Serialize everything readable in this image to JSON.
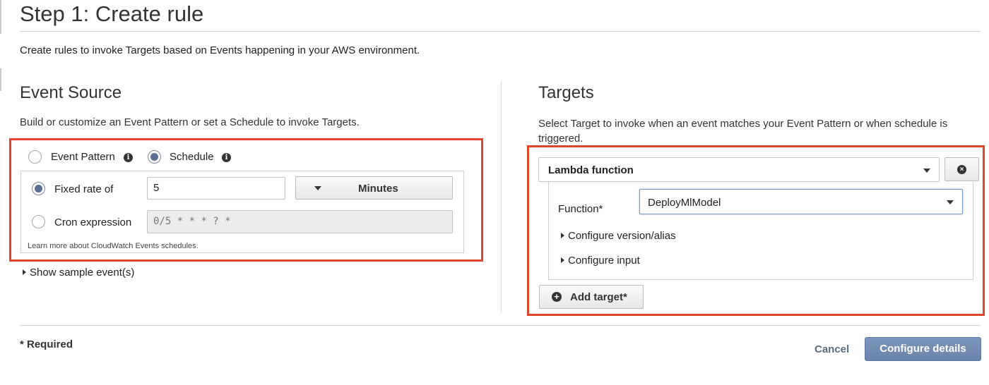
{
  "page": {
    "title": "Step 1: Create rule",
    "description": "Create rules to invoke Targets based on Events happening in your AWS environment."
  },
  "event_source": {
    "heading": "Event Source",
    "subtitle": "Build or customize an Event Pattern or set a Schedule to invoke Targets.",
    "options": {
      "event_pattern": "Event Pattern",
      "schedule": "Schedule",
      "selected": "Schedule"
    },
    "fixed_rate_label": "Fixed rate of",
    "fixed_rate_value": "5",
    "unit_label": "Minutes",
    "cron_label": "Cron expression",
    "cron_placeholder": "0/5 * * * ? *",
    "schedule_mode": "Fixed rate of",
    "learn_more": "Learn more about CloudWatch Events schedules.",
    "show_sample": "Show sample event(s)"
  },
  "targets": {
    "heading": "Targets",
    "subtitle": "Select Target to invoke when an event matches your Event Pattern or when schedule is triggered.",
    "target_type": "Lambda function",
    "function_label": "Function*",
    "function_value": "DeployMlModel",
    "configure_version": "Configure version/alias",
    "configure_input": "Configure input",
    "add_target": "Add target*"
  },
  "footer": {
    "required_note": "* Required",
    "cancel": "Cancel",
    "configure_details": "Configure details"
  },
  "colors": {
    "highlight_box": "#e0452c",
    "primary_button": "#7088ae",
    "radio_selected": "#5c7095"
  },
  "icons": [
    "info-icon",
    "chevron-down-icon",
    "chevron-right-icon",
    "plus-circle-icon",
    "close-circle-icon"
  ]
}
